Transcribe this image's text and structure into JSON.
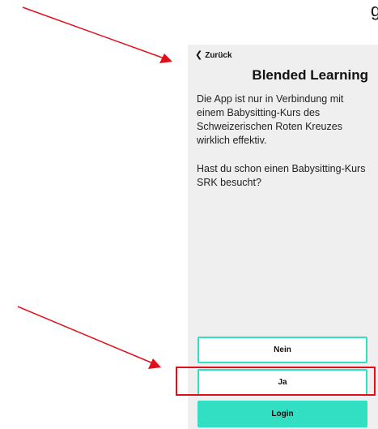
{
  "header": {
    "glyph": "g"
  },
  "nav": {
    "back_label": "Zurück",
    "back_icon": "chevron-left-icon"
  },
  "page": {
    "title": "Blended Learning",
    "paragraph1": "Die App ist nur in Verbindung mit einem Babysitting-Kurs des Schweizerischen Roten Kreuzes wirklich effektiv.",
    "paragraph2": "Hast du schon einen Babysitting-Kurs SRK besucht?"
  },
  "buttons": {
    "nein": "Nein",
    "ja": "Ja",
    "login": "Login"
  },
  "colors": {
    "accent": "#33dfc3",
    "annotation": "#e0101a",
    "panel_bg": "#efefef"
  }
}
